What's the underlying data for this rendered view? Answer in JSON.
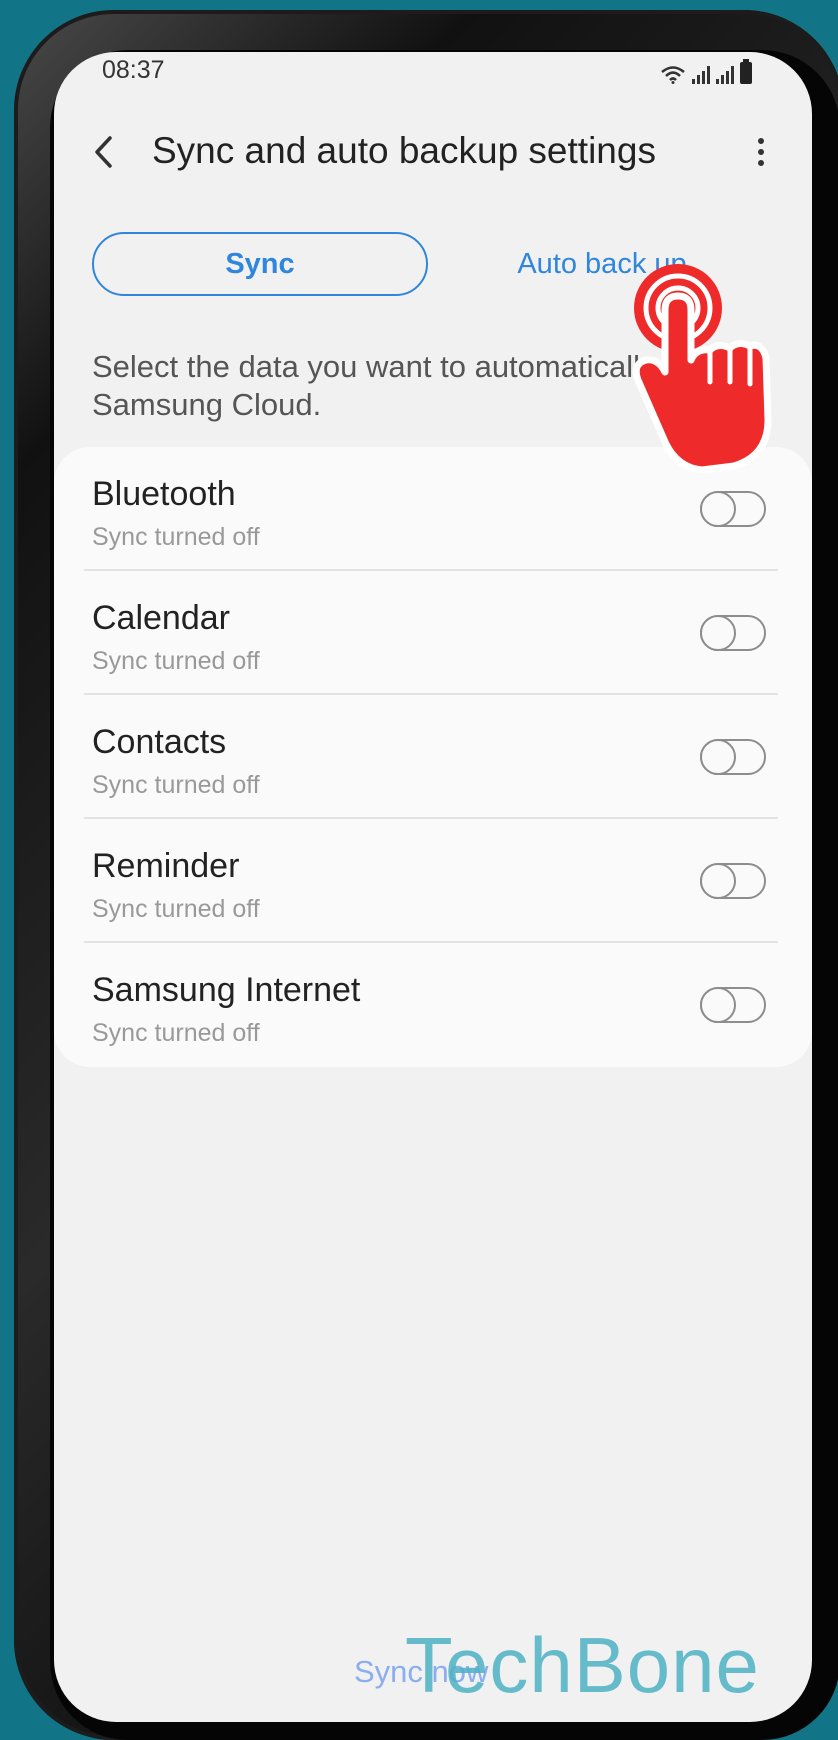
{
  "status_bar": {
    "time": "08:37",
    "icons": [
      "wifi-icon",
      "signal-icon",
      "signal-icon",
      "battery-icon"
    ]
  },
  "toolbar": {
    "title": "Sync and auto backup settings",
    "back_icon": "chevron-left-icon",
    "more_icon": "more-vertical-icon"
  },
  "tabs": [
    {
      "label": "Sync",
      "selected": true
    },
    {
      "label": "Auto back up",
      "selected": false
    }
  ],
  "description": "Select the data you want to automatically  with Samsung Cloud.",
  "items": [
    {
      "title": "Bluetooth",
      "subtitle": "Sync turned off",
      "enabled": false
    },
    {
      "title": "Calendar",
      "subtitle": "Sync turned off",
      "enabled": false
    },
    {
      "title": "Contacts",
      "subtitle": "Sync turned off",
      "enabled": false
    },
    {
      "title": "Reminder",
      "subtitle": "Sync turned off",
      "enabled": false
    },
    {
      "title": "Samsung Internet",
      "subtitle": "Sync turned off",
      "enabled": false
    }
  ],
  "footer": {
    "sync_now_label": "Sync now"
  },
  "watermark": "TechBone",
  "colors": {
    "background": "#127587",
    "accent": "#2f86db",
    "screen": "#f1f1f1",
    "tap_indicator": "#ee2a2a"
  }
}
